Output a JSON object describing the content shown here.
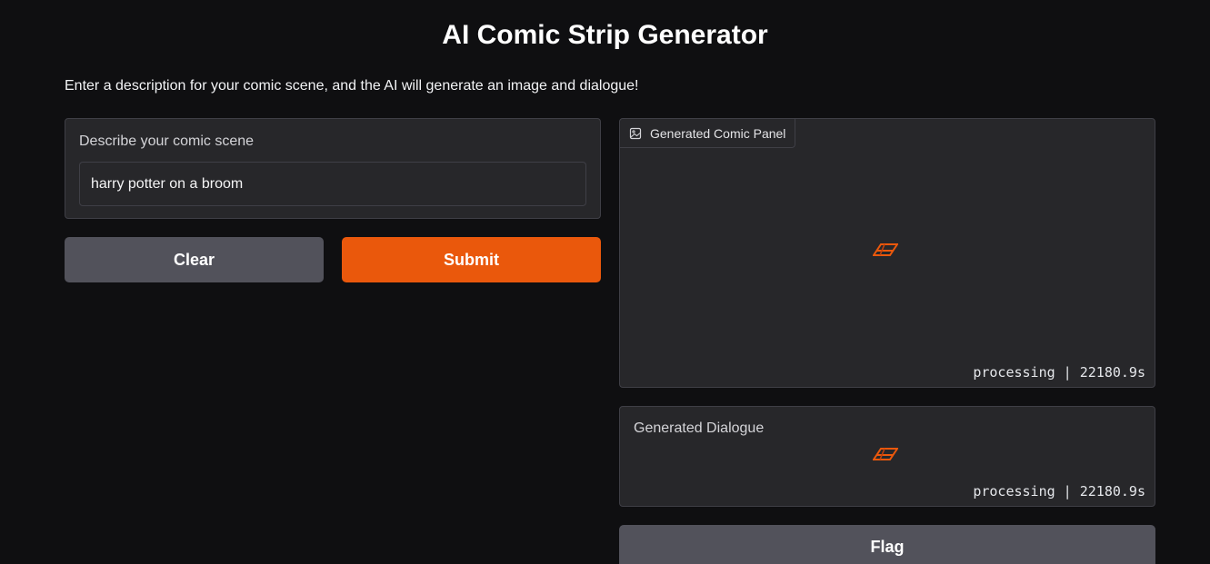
{
  "header": {
    "title": "AI Comic Strip Generator",
    "description": "Enter a description for your comic scene, and the AI will generate an image and dialogue!"
  },
  "input": {
    "label": "Describe your comic scene",
    "value": "harry potter on a broom",
    "placeholder": ""
  },
  "buttons": {
    "clear_label": "Clear",
    "submit_label": "Submit",
    "flag_label": "Flag"
  },
  "outputs": {
    "image": {
      "label": "Generated Comic Panel",
      "icon": "image-icon",
      "status": "processing | 22180.9s"
    },
    "dialogue": {
      "label": "Generated Dialogue",
      "status": "processing | 22180.9s"
    }
  },
  "colors": {
    "background": "#0f0f11",
    "panel": "#27272a",
    "border": "#3f3f46",
    "accent": "#ea580c",
    "secondary_button": "#52525b",
    "loader": "#ea580c"
  }
}
